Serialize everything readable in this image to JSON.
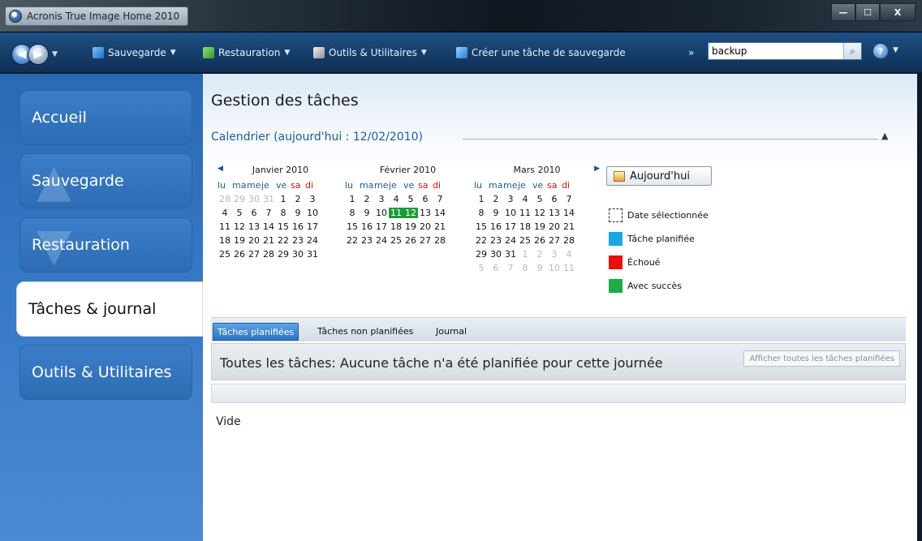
{
  "window": {
    "title": "Acronis True Image Home 2010",
    "minimize": "—",
    "maximize": "☐",
    "close": "X"
  },
  "toolbar": {
    "back": "◀",
    "forward": "▶",
    "items": [
      {
        "label": "Sauvegarde",
        "icon": "backup-icon"
      },
      {
        "label": "Restauration",
        "icon": "restore-icon"
      },
      {
        "label": "Outils & Utilitaires",
        "icon": "tools-icon"
      },
      {
        "label": "Créer une tâche de sauvegarde",
        "icon": "create-task-icon"
      }
    ],
    "overflow": "»",
    "search": {
      "value": "backup",
      "placeholder": ""
    },
    "help": "?"
  },
  "sidebar": {
    "items": [
      {
        "label": "Accueil"
      },
      {
        "label": "Sauvegarde"
      },
      {
        "label": "Restauration"
      },
      {
        "label": "Tâches & journal",
        "active": true
      },
      {
        "label": "Outils & Utilitaires"
      }
    ]
  },
  "main": {
    "title": "Gestion des tâches",
    "calendar_heading": "Calendrier (aujourd'hui : 12/02/2010)",
    "today_button": "Aujourd'hui",
    "dow": [
      "lu",
      "ma",
      "me",
      "je",
      "ve",
      "sa",
      "di"
    ],
    "months": [
      {
        "name": "Janvier 2010"
      },
      {
        "name": "Février 2010"
      },
      {
        "name": "Mars 2010"
      }
    ],
    "legend": [
      {
        "label": "Date sélectionnée",
        "color": "#ffffff"
      },
      {
        "label": "Tâche planifiée",
        "color": "#18a8e6"
      },
      {
        "label": "Échoué",
        "color": "#e80f0f"
      },
      {
        "label": "Avec succès",
        "color": "#1cab48"
      }
    ],
    "tabs": [
      "Tâches planifiées",
      "Tâches non planifiées",
      "Journal"
    ],
    "active_tab": "Tâches planifiées",
    "info_text": "Toutes les tâches: Aucune tâche n'a été planifiée pour cette journée",
    "show_all_button": "Afficher toutes les tâches planifiées",
    "empty_text": "Vide"
  }
}
